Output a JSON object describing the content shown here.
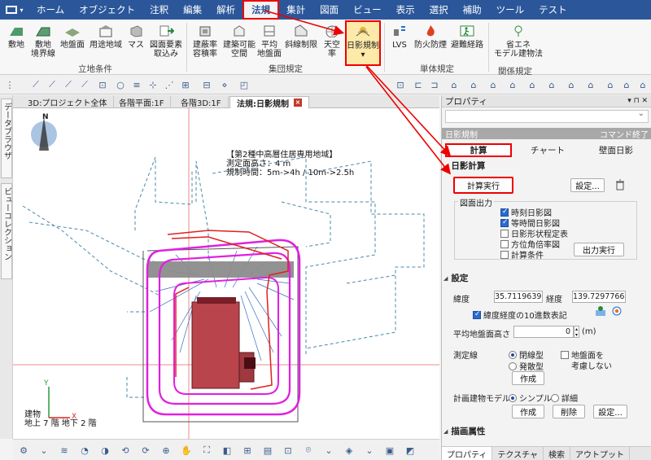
{
  "menu": {
    "tabs": [
      "ホーム",
      "オブジェクト",
      "注釈",
      "編集",
      "解析",
      "法規",
      "集計",
      "図面",
      "ビュー",
      "表示",
      "選択",
      "補助",
      "ツール",
      "テスト"
    ],
    "active_index": 5
  },
  "ribbon": {
    "buttons": [
      {
        "label1": "敷地",
        "label2": ""
      },
      {
        "label1": "敷地",
        "label2": "境界線"
      },
      {
        "label1": "地盤面",
        "label2": ""
      },
      {
        "label1": "用途地域",
        "label2": ""
      },
      {
        "label1": "マス",
        "label2": ""
      },
      {
        "label1": "図面要素",
        "label2": "取込み"
      },
      {
        "label1": "建蔽率",
        "label2": "容積率"
      },
      {
        "label1": "建築可能",
        "label2": "空間"
      },
      {
        "label1": "平均",
        "label2": "地盤面"
      },
      {
        "label1": "斜線制限",
        "label2": ""
      },
      {
        "label1": "天空率",
        "label2": ""
      },
      {
        "label1": "日影規制",
        "label2": "▾"
      },
      {
        "label1": "LVS",
        "label2": ""
      },
      {
        "label1": "防火防煙",
        "label2": ""
      },
      {
        "label1": "避難経路",
        "label2": ""
      },
      {
        "label1": "省エネ",
        "label2": "モデル建物法"
      }
    ],
    "groups": [
      "立地条件",
      "集団規定",
      "単体規定",
      "関係規定"
    ]
  },
  "left_tabs": [
    "データブラウザ",
    "ビューコレクション"
  ],
  "doc_tabs": [
    "3D:プロジェクト全体",
    "各階平面:1F",
    "各階3D:1F",
    "法規:日影規制"
  ],
  "doc_tab_close": "×",
  "canvas": {
    "north": "N",
    "zone_title": "【第2種中高層住居専用地域】",
    "measure_height": "測定面高さ：4 m",
    "restriction_time": "規制時間：5m->4h / 10m->2.5h",
    "building_label": "建物",
    "building_floors": "地上 7 階  地下 2 階",
    "axis_y": "Y",
    "axis_x": "X"
  },
  "panel": {
    "title": "プロパティ",
    "title_controls": "▾ ⊓ ✕",
    "command_name": "日影規制",
    "command_end": "コマンド終了",
    "tabs": [
      "計算",
      "チャート",
      "壁面日影"
    ],
    "sec_calc": "日影計算",
    "btn_calc": "計算実行",
    "btn_settings": "設定...",
    "output_legend": "図面出力",
    "outputs": [
      {
        "label": "時刻日影図",
        "checked": true
      },
      {
        "label": "等時間日影図",
        "checked": true
      },
      {
        "label": "日影形状程定表",
        "checked": false
      },
      {
        "label": "方位角倍率図",
        "checked": false
      },
      {
        "label": "計算条件",
        "checked": false
      }
    ],
    "btn_output": "出力実行",
    "sec_settings": "設定",
    "lat_label": "緯度",
    "lat_value": "35.7119639",
    "lon_label": "経度",
    "lon_value": "139.7297766",
    "decimal_label": "緯度経度の10進数表記",
    "avg_ground_label": "平均地盤面高さ",
    "avg_ground_value": "0",
    "avg_ground_unit": "(m)",
    "measure_line_label": "測定線",
    "radio_closed": "閉線型",
    "radio_open": "発散型",
    "ground_ignore": "地盤面を",
    "ground_ignore2": "考慮しない",
    "btn_create": "作成",
    "model_label": "計画建物モデル",
    "radio_simple": "シンプル",
    "radio_detail": "詳細",
    "btn_create2": "作成",
    "btn_delete": "削除",
    "btn_settings2": "設定...",
    "sec_drawing": "描画属性",
    "bottom_tabs": [
      "プロパティ",
      "テクスチャ",
      "検索",
      "アウトプット"
    ]
  },
  "colors": {
    "menubar": "#2b579a",
    "highlight": "#e00000",
    "shadow_magenta": "#e020e0",
    "building": "#b9444c",
    "plan_gray": "#8c8c8c"
  }
}
